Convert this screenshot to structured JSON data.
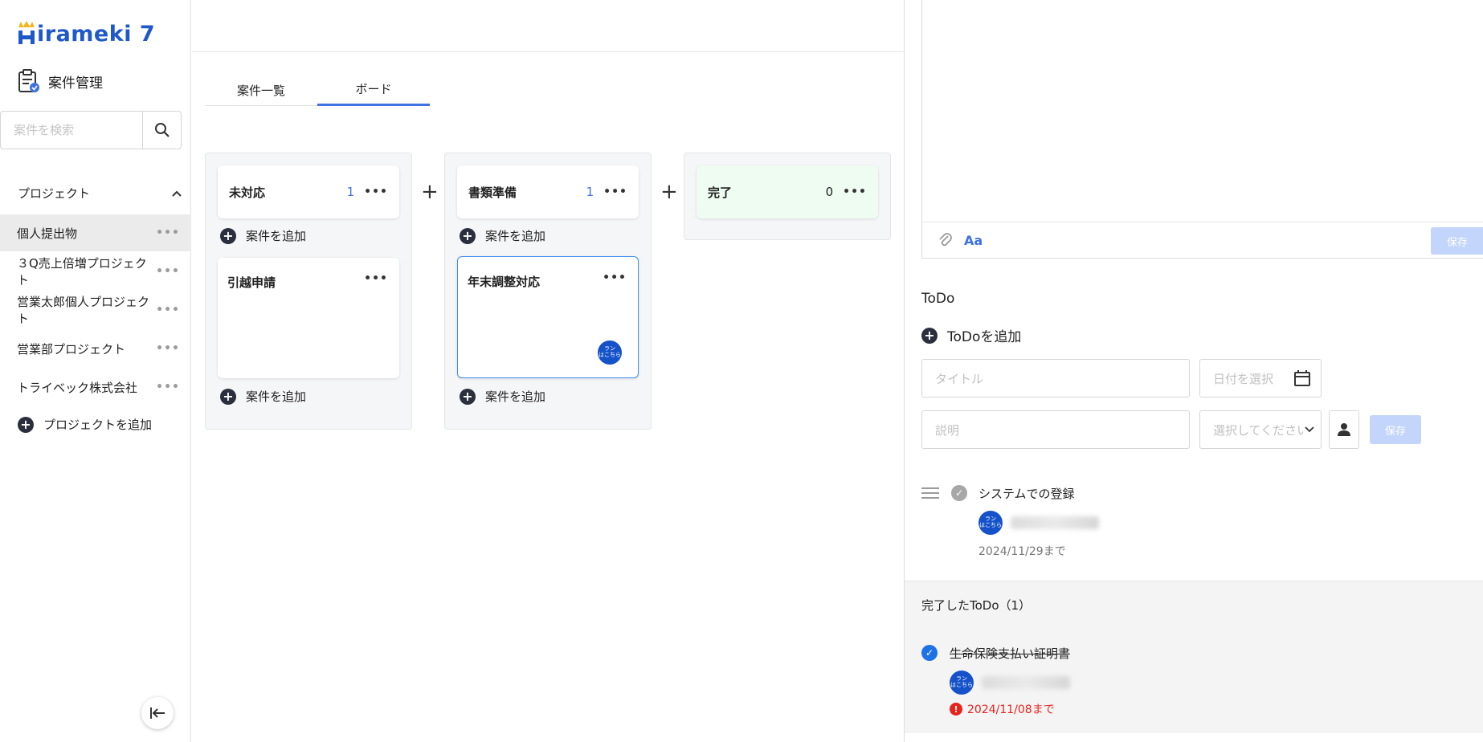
{
  "sidebar": {
    "brand": "Hirameki 7",
    "module_label": "案件管理",
    "search_placeholder": "案件を検索",
    "projects_header": "プロジェクト",
    "projects": [
      "個人提出物",
      "３Q売上倍増プロジェクト",
      "営業太郎個人プロジェクト",
      "営業部プロジェクト",
      "トライベック株式会社"
    ],
    "add_project": "プロジェクトを追加"
  },
  "tabs": [
    "案件一覧",
    "ボード"
  ],
  "board": {
    "columns": [
      {
        "title": "未対応",
        "count": "1",
        "card": "引越申請"
      },
      {
        "title": "書類準備",
        "count": "1",
        "card": "年末調整対応"
      },
      {
        "title": "完了",
        "count": "0"
      }
    ],
    "add_case": "案件を追加",
    "plus": "+",
    "avatar_text": "ラン\nはこちら"
  },
  "panel": {
    "aa_label": "Aa",
    "save_label": "保存",
    "todo_title": "ToDo",
    "todo_add": "ToDoを追加",
    "title_placeholder": "タイトル",
    "date_placeholder": "日付を選択",
    "desc_placeholder": "説明",
    "select_placeholder": "選択してください",
    "todo_items": [
      {
        "title": "システムでの登録",
        "due": "2024/11/29まで"
      }
    ],
    "done_header": "完了したToDo（1）",
    "done_items": [
      {
        "title": "生命保険支払い証明書",
        "due": "2024/11/08まで"
      }
    ]
  },
  "colors": {
    "accent": "#3f72e3",
    "brand": "#1f58c9",
    "overdue": "#e8221c",
    "done_col": "#effcf2"
  }
}
